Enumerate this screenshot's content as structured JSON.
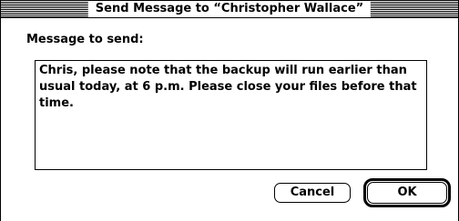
{
  "dialog": {
    "title": "Send Message to “Christopher Wallace”",
    "prompt_label": "Message to send:",
    "message_text": "Chris, please note that the backup will run earlier than usual today, at 6 p.m. Please close your files before that time."
  },
  "buttons": {
    "cancel_label": "Cancel",
    "ok_label": "OK"
  }
}
